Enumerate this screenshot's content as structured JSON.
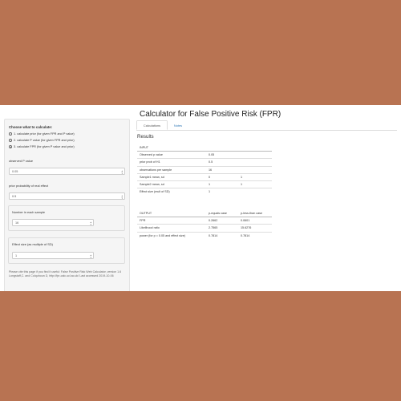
{
  "page_title": "Calculator for False Positive Risk (FPR)",
  "sidebar": {
    "heading": "Choose what to calculate:",
    "options": [
      {
        "label": "1. calculate prior (for given FPR and P value)",
        "checked": false
      },
      {
        "label": "2. calculate P value (for given FPR and prior)",
        "checked": false
      },
      {
        "label": "3. calculate FPR (for given P value and prior)",
        "checked": true
      }
    ],
    "observed_p": {
      "label": "observed P value",
      "value": "0.05"
    },
    "prior_prob": {
      "label": "prior probability of real effect",
      "value": "0.5"
    },
    "n_sample": {
      "label": "Number in each sample",
      "value": "16"
    },
    "effect_size": {
      "label": "Effect size (as multiple of SD)",
      "value": "1"
    },
    "citation": "Please cite this page if you find it useful: False Positive Risk Web Calculator, version 1.6 Longstaff,C. and Colquhoun D, http://fpr-calc.ucl.ac.uk/ Last accessed 2019-10-06"
  },
  "tabs": [
    {
      "label": "Calculations",
      "active": true
    },
    {
      "label": "Notes",
      "active": false
    }
  ],
  "results_title": "Results",
  "input_table": {
    "header": [
      "INPUT",
      "",
      ""
    ],
    "rows": [
      [
        "Observed p value",
        "0.05",
        ""
      ],
      [
        "prior prob of H1",
        "0.5",
        ""
      ],
      [
        "observations per sample",
        "16",
        ""
      ],
      [
        "Sample1 mean, sd",
        "0",
        "1"
      ],
      [
        "Sample2 mean, sd",
        "1",
        "1"
      ],
      [
        "Effect size (mult of SD)",
        "1",
        ""
      ]
    ]
  },
  "output_table": {
    "header": [
      "OUTPUT",
      "p-equals case",
      "p-less-than case"
    ],
    "rows": [
      [
        "FPR",
        "0.2662",
        "0.0601"
      ],
      [
        "Likelihood ratio",
        "2.7565",
        "15.6276"
      ],
      [
        "power (for p = 0.05 and effect size)",
        "0.7814",
        "0.7814"
      ]
    ]
  }
}
